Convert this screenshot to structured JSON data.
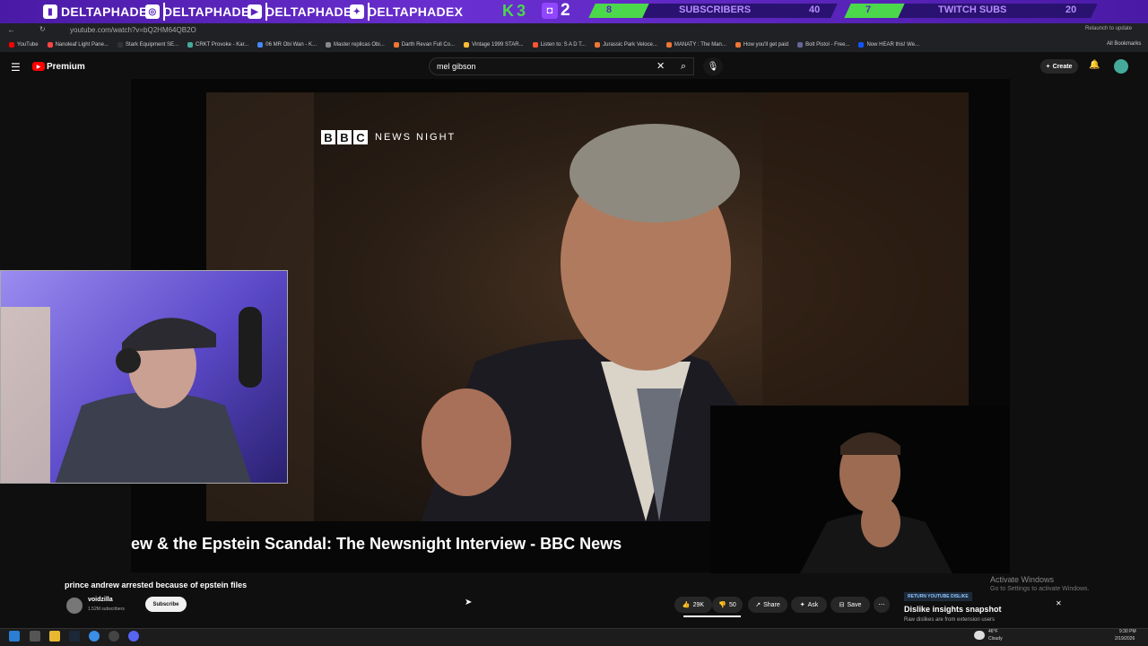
{
  "overlay": {
    "handles": [
      "DELTAPHADE",
      "DELTAPHADE",
      "DELTAPHADE",
      "DELTAPHADEX"
    ],
    "brand": "K3",
    "goal1": {
      "current": "8",
      "label": "SUBSCRIBERS",
      "target": "40"
    },
    "goal2": {
      "current": "7",
      "label": "TWITCH SUBS",
      "target": "20"
    }
  },
  "browser": {
    "url": "youtube.com/watch?v=bQ2HM64QB2O",
    "relaunch": "Relaunch to update",
    "bookmarks": [
      "YouTube",
      "Nanoleaf Light Pane...",
      "Stark Equipment SE...",
      "CRKT Provoke - Kar...",
      "06 MR Obi Wan - K...",
      "Master replicas Obi...",
      "Darth Revan Full Co...",
      "Vintage 1999 STAR...",
      "Listen to: S A D T...",
      "Jurassic Park Veloce...",
      "MANATY : The Man...",
      "How you'll get paid",
      "Bolt Pistol - Free...",
      "Now HEAR this! We..."
    ],
    "all_bookmarks": "All Bookmarks"
  },
  "youtube": {
    "logo": "Premium",
    "search_value": "mel gibson",
    "create_label": "Create",
    "video_title_overlay": "ew & the Epstein Scandal: The Newsnight Interview - BBC News",
    "bbc_letters": [
      "B",
      "B",
      "C"
    ],
    "newsnight": "NEWS NIGHT",
    "page_title": "prince andrew arrested because of epstein files",
    "channel_name": "voidzilla",
    "subscribers": "1.52M subscribers",
    "subscribe_label": "Subscribe",
    "likes": "29K",
    "dislikes": "50",
    "share_label": "Share",
    "ask_label": "Ask",
    "save_label": "Save",
    "ryd_tag": "RETURN YOUTUBE DISLIKE",
    "ryd_title": "Dislike insights snapshot",
    "ryd_sub": "Raw dislikes are from extension users"
  },
  "windows": {
    "activate_title": "Activate Windows",
    "activate_sub": "Go to Settings to activate Windows.",
    "weather_temp": "46°F",
    "weather_desc": "Cloudy",
    "time": "9:30 PM",
    "date": "2/19/2026"
  },
  "colors": {
    "overlay_purple": "#5a22c0",
    "goal_green": "#4bd84b",
    "yt_red": "#ff0000",
    "twitch": "#9146ff"
  }
}
